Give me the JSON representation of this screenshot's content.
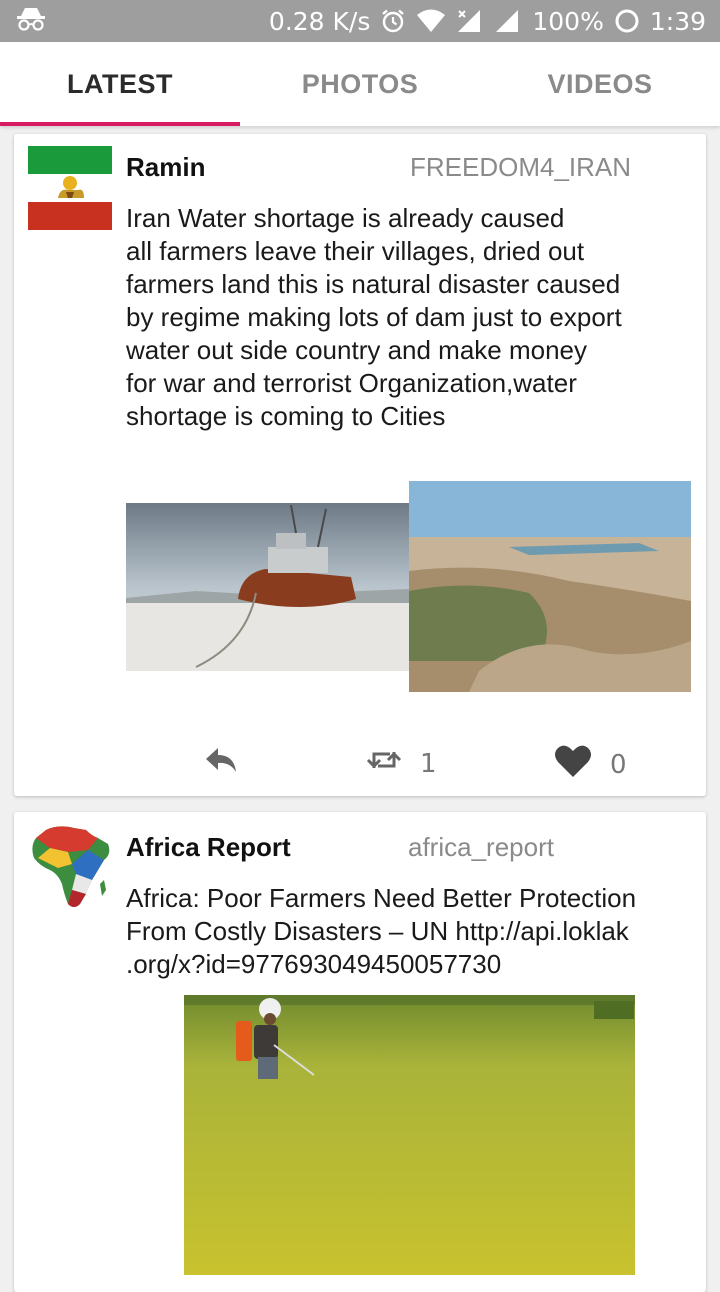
{
  "status_bar": {
    "speed": "0.28 K/s",
    "battery": "100%",
    "time": "1:39"
  },
  "tabs": [
    {
      "label": "LATEST",
      "active": true
    },
    {
      "label": "PHOTOS",
      "active": false
    },
    {
      "label": "VIDEOS",
      "active": false
    }
  ],
  "posts": [
    {
      "name": "Ramin",
      "handle": "FREEDOM4_IRAN",
      "text": "Iran Water shortage is already caused\nall farmers leave their villages, dried out\nfarmers land this is natural disaster caused\nby regime making lots of dam just to export\nwater out side country and make money\nfor war and terrorist Organization,water\nshortage is coming to Cities",
      "retweets": "1",
      "likes": "0"
    },
    {
      "name": "Africa Report",
      "handle": "africa_report",
      "text": "Africa: Poor Farmers Need Better Protection\nFrom Costly Disasters – UN http://api.loklak\n.org/x?id=977693049450057730"
    }
  ],
  "colors": {
    "accent": "#d81b60",
    "status_bar": "#9e9e9e"
  }
}
